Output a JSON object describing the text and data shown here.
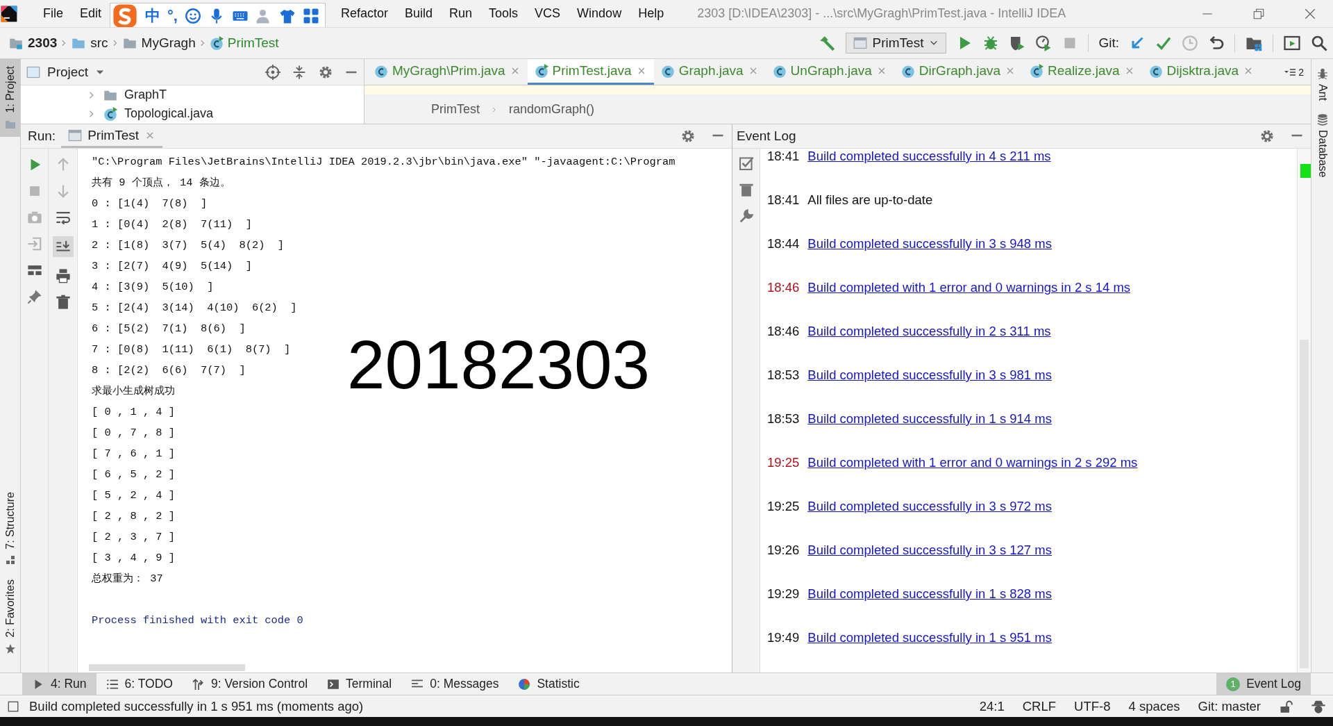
{
  "title_bar": {
    "menu": [
      "File",
      "Edit",
      "Refactor",
      "Build",
      "Run",
      "Tools",
      "VCS",
      "Window",
      "Help"
    ],
    "title": "2303 [D:\\IDEA\\2303] - ...\\src\\MyGragh\\PrimTest.java - IntelliJ IDEA"
  },
  "input_method_bar": {
    "labels": [
      "中",
      "°,"
    ]
  },
  "nav_bar": {
    "breadcrumbs": [
      {
        "label": "2303",
        "kind": "project"
      },
      {
        "label": "src",
        "kind": "source"
      },
      {
        "label": "MyGragh",
        "kind": "package"
      },
      {
        "label": "PrimTest",
        "kind": "class"
      }
    ],
    "run_config": "PrimTest",
    "git_label": "Git:"
  },
  "left_stripe": [
    {
      "label": "1: Project",
      "selected": true
    },
    {
      "label": "7: Structure",
      "selected": false
    },
    {
      "label": "2: Favorites",
      "selected": false
    }
  ],
  "right_stripe": [
    "Ant",
    "Database"
  ],
  "project_panel": {
    "title": "Project",
    "tree": [
      {
        "label": "GraphT",
        "kind": "package"
      },
      {
        "label": "Topological.java",
        "kind": "class"
      }
    ]
  },
  "editor": {
    "tabs": [
      {
        "label": "MyGragh\\Prim.java",
        "selected": false,
        "runnable": false
      },
      {
        "label": "PrimTest.java",
        "selected": true,
        "runnable": true
      },
      {
        "label": "Graph.java",
        "selected": false,
        "runnable": false
      },
      {
        "label": "UnGraph.java",
        "selected": false,
        "runnable": false
      },
      {
        "label": "DirGraph.java",
        "selected": false,
        "runnable": false
      },
      {
        "label": "Realize.java",
        "selected": false,
        "runnable": true
      },
      {
        "label": "Dijsktra.java",
        "selected": false,
        "runnable": false
      }
    ],
    "overflow_count": "2",
    "breadcrumb": [
      "PrimTest",
      "randomGraph()"
    ]
  },
  "run_panel": {
    "label": "Run:",
    "tab": "PrimTest",
    "overlay_text": "20182303",
    "lines": [
      {
        "text": "\"C:\\Program Files\\JetBrains\\IntelliJ IDEA 2019.2.3\\jbr\\bin\\java.exe\" \"-javaagent:C:\\Program",
        "kind": "command"
      },
      {
        "text": "共有 9 个顶点， 14 条边。",
        "kind": "output"
      },
      {
        "text": "0 : [1(4)  7(8)  ]",
        "kind": "output"
      },
      {
        "text": "1 : [0(4)  2(8)  7(11)  ]",
        "kind": "output"
      },
      {
        "text": "2 : [1(8)  3(7)  5(4)  8(2)  ]",
        "kind": "output"
      },
      {
        "text": "3 : [2(7)  4(9)  5(14)  ]",
        "kind": "output"
      },
      {
        "text": "4 : [3(9)  5(10)  ]",
        "kind": "output"
      },
      {
        "text": "5 : [2(4)  3(14)  4(10)  6(2)  ]",
        "kind": "output"
      },
      {
        "text": "6 : [5(2)  7(1)  8(6)  ]",
        "kind": "output"
      },
      {
        "text": "7 : [0(8)  1(11)  6(1)  8(7)  ]",
        "kind": "output"
      },
      {
        "text": "8 : [2(2)  6(6)  7(7)  ]",
        "kind": "output"
      },
      {
        "text": "求最小生成树成功",
        "kind": "output"
      },
      {
        "text": "[ 0 , 1 , 4 ]",
        "kind": "output"
      },
      {
        "text": "[ 0 , 7 , 8 ]",
        "kind": "output"
      },
      {
        "text": "[ 7 , 6 , 1 ]",
        "kind": "output"
      },
      {
        "text": "[ 6 , 5 , 2 ]",
        "kind": "output"
      },
      {
        "text": "[ 5 , 2 , 4 ]",
        "kind": "output"
      },
      {
        "text": "[ 2 , 8 , 2 ]",
        "kind": "output"
      },
      {
        "text": "[ 2 , 3 , 7 ]",
        "kind": "output"
      },
      {
        "text": "[ 3 , 4 , 9 ]",
        "kind": "output"
      },
      {
        "text": "总权重为： 37",
        "kind": "output"
      },
      {
        "text": "Process finished with exit code 0",
        "kind": "exit"
      }
    ]
  },
  "event_log": {
    "title": "Event Log",
    "entries": [
      {
        "time": "18:41",
        "message": "Build completed successfully in 4 s 211 ms",
        "error": false,
        "link": true
      },
      {
        "time": "18:41",
        "message": "All files are up-to-date",
        "error": false,
        "link": false
      },
      {
        "time": "18:44",
        "message": "Build completed successfully in 3 s 948 ms",
        "error": false,
        "link": true
      },
      {
        "time": "18:46",
        "message": "Build completed with 1 error and 0 warnings in 2 s 14 ms",
        "error": true,
        "link": true
      },
      {
        "time": "18:46",
        "message": "Build completed successfully in 2 s 311 ms",
        "error": false,
        "link": true
      },
      {
        "time": "18:53",
        "message": "Build completed successfully in 3 s 981 ms",
        "error": false,
        "link": true
      },
      {
        "time": "18:53",
        "message": "Build completed successfully in 1 s 914 ms",
        "error": false,
        "link": true
      },
      {
        "time": "19:25",
        "message": "Build completed with 1 error and 0 warnings in 2 s 292 ms",
        "error": true,
        "link": true
      },
      {
        "time": "19:25",
        "message": "Build completed successfully in 3 s 972 ms",
        "error": false,
        "link": true
      },
      {
        "time": "19:26",
        "message": "Build completed successfully in 3 s 127 ms",
        "error": false,
        "link": true
      },
      {
        "time": "19:29",
        "message": "Build completed successfully in 1 s 828 ms",
        "error": false,
        "link": true
      },
      {
        "time": "19:49",
        "message": "Build completed successfully in 1 s 951 ms",
        "error": false,
        "link": true
      }
    ]
  },
  "tool_windows": [
    {
      "label": "4: Run",
      "kind": "run",
      "selected": true
    },
    {
      "label": "6: TODO",
      "kind": "todo",
      "selected": false
    },
    {
      "label": "9: Version Control",
      "kind": "vcs",
      "selected": false
    },
    {
      "label": "Terminal",
      "kind": "terminal",
      "selected": false
    },
    {
      "label": "0: Messages",
      "kind": "messages",
      "selected": false
    },
    {
      "label": "Statistic",
      "kind": "statistic",
      "selected": false
    }
  ],
  "event_log_button": {
    "label": "Event Log",
    "badge": "1"
  },
  "status_bar": {
    "message": "Build completed successfully in 1 s 951 ms (moments ago)",
    "items": [
      "24:1",
      "CRLF",
      "UTF-8",
      "4 spaces",
      "Git: master"
    ]
  }
}
